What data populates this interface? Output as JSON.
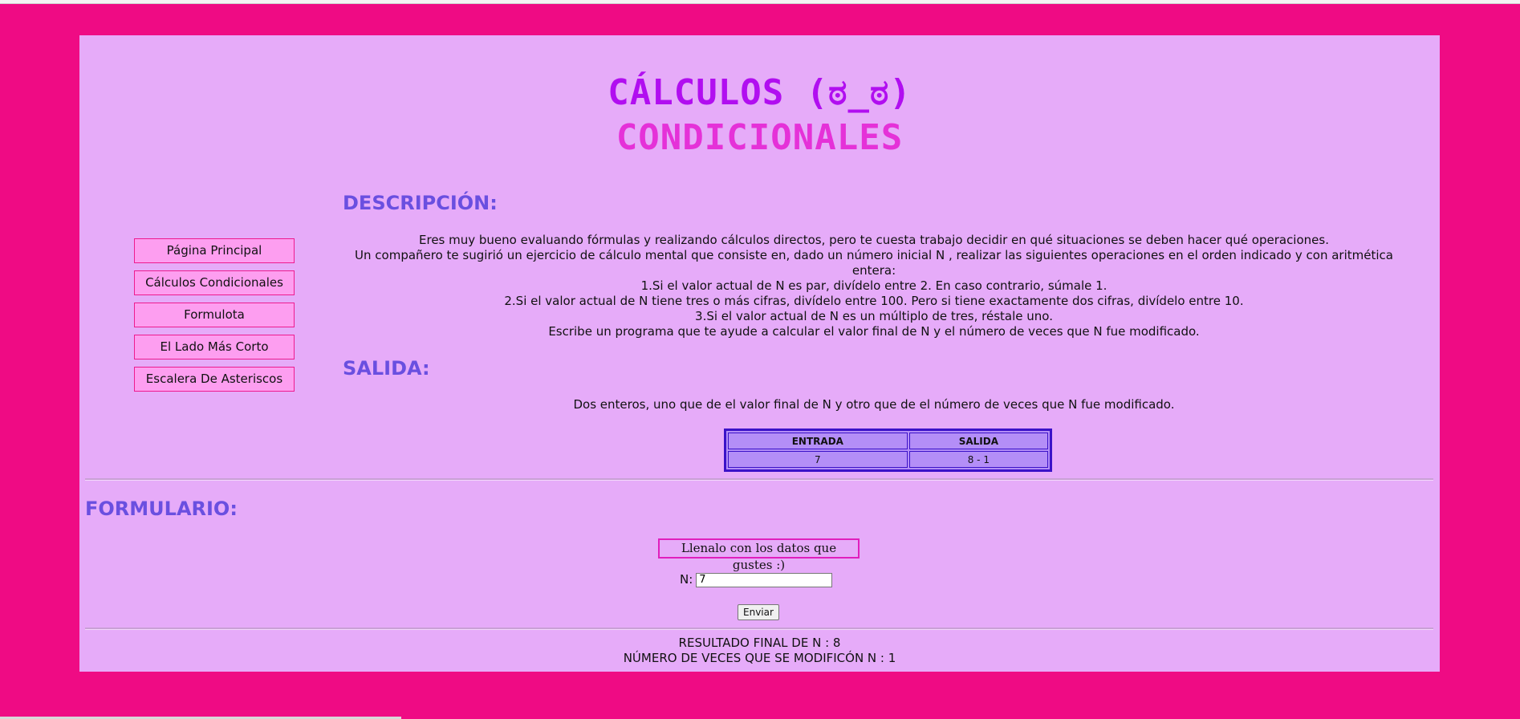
{
  "header": {
    "title_line1": "CÁLCULOS (ಠ_ಠ)",
    "title_line2": "CONDICIONALES"
  },
  "nav": {
    "items": [
      {
        "label": "Página Principal"
      },
      {
        "label": "Cálculos Condicionales"
      },
      {
        "label": "Formulota"
      },
      {
        "label": "El Lado Más Corto"
      },
      {
        "label": "Escalera De Asteriscos"
      }
    ]
  },
  "descripcion": {
    "heading": "DESCRIPCIÓN:",
    "lines": [
      "Eres muy bueno evaluando fórmulas y realizando cálculos directos, pero te cuesta trabajo decidir en qué situaciones se deben hacer qué operaciones.",
      "Un compañero te sugirió un ejercicio de cálculo mental que consiste en, dado un número inicial N , realizar las siguientes operaciones en el orden indicado y con aritmética entera:",
      "1.Si el valor actual de N es par, divídelo entre 2. En caso contrario, súmale 1.",
      "2.Si el valor actual de N tiene tres o más cifras, divídelo entre 100. Pero si tiene exactamente dos cifras, divídelo entre 10.",
      "3.Si el valor actual de N es un múltiplo de tres, réstale uno.",
      "Escribe un programa que te ayude a calcular el valor final de N y el número de veces que N fue modificado."
    ]
  },
  "salida": {
    "heading": "SALIDA:",
    "text": "Dos enteros, uno que de el valor final de N y otro que de el número de veces que N fue modificado.",
    "table": {
      "headers": [
        "ENTRADA",
        "SALIDA"
      ],
      "rows": [
        [
          "7",
          "8 - 1"
        ]
      ]
    }
  },
  "formulario": {
    "heading": "FORMULARIO:",
    "box_text": "Llenalo con los datos que gustes :)",
    "n_label": "N:",
    "n_value": "7",
    "submit_label": "Enviar"
  },
  "resultado": {
    "line1": "RESULTADO FINAL DE N : 8",
    "line2": "NÚMERO DE VECES QUE SE MODIFICÓN N : 1"
  },
  "colors": {
    "background": "#ef0b84",
    "panel": "#e6abf9",
    "title1": "#b10ef0",
    "title2": "#e531d8",
    "heading": "#6a4fe0",
    "nav_bg": "#fd9ef0",
    "table_border": "#3b12c8"
  }
}
